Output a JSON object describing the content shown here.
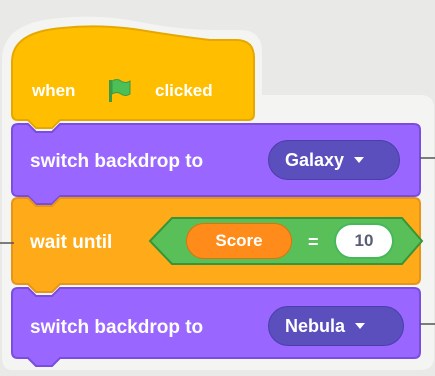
{
  "script": {
    "hat_block": {
      "prefix": "when",
      "icon": "green-flag-icon",
      "suffix": "clicked",
      "color": "#ffbf00"
    },
    "blocks": [
      {
        "label": "switch backdrop to",
        "dropdown_value": "Galaxy",
        "color": "#9966ff"
      },
      {
        "label": "wait until",
        "condition": {
          "reporter": "Score",
          "operator": "=",
          "value": "10"
        },
        "color": "#ffab19"
      },
      {
        "label": "switch backdrop to",
        "dropdown_value": "Nebula",
        "color": "#9966ff"
      }
    ]
  },
  "colors": {
    "looks_block": "#9966ff",
    "control_block": "#ffab19",
    "events_block": "#ffbf00",
    "operator_block": "#59c059",
    "variable_reporter": "#ff8c1a",
    "flag": "#4cbf56",
    "background": "#e9e9e7"
  }
}
